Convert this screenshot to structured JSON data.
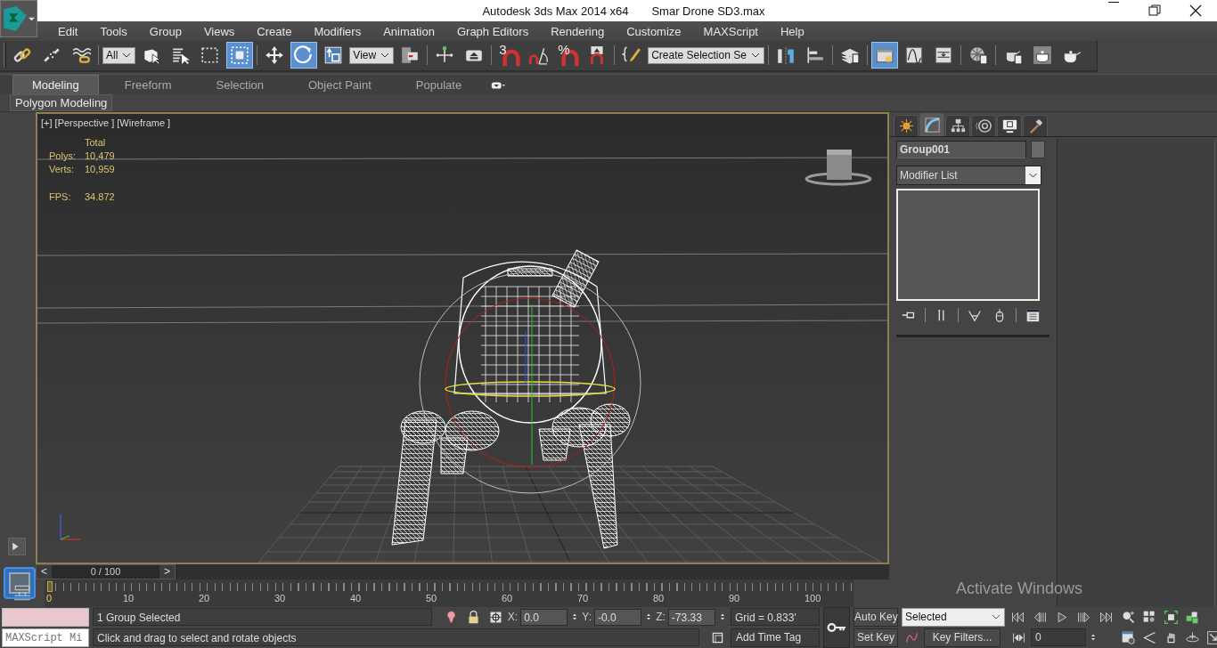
{
  "title_bar": {
    "app": "Autodesk 3ds Max  2014 x64",
    "file": "Smar Drone SD3.max"
  },
  "menu": [
    "Edit",
    "Tools",
    "Group",
    "Views",
    "Create",
    "Modifiers",
    "Animation",
    "Graph Editors",
    "Rendering",
    "Customize",
    "MAXScript",
    "Help"
  ],
  "toolbar": [
    {
      "kind": "link",
      "selected": false
    },
    {
      "kind": "unlink",
      "selected": false
    },
    {
      "kind": "bind",
      "selected": false
    },
    {
      "kind": "separator"
    },
    {
      "kind": "dropdown",
      "value": "All"
    },
    {
      "kind": "select-object",
      "selected": false
    },
    {
      "kind": "select-by-name",
      "selected": false
    },
    {
      "kind": "region-select",
      "selected": false
    },
    {
      "kind": "window-crossing",
      "selected": true
    },
    {
      "kind": "separator"
    },
    {
      "kind": "move",
      "selected": false
    },
    {
      "kind": "rotate",
      "selected": true
    },
    {
      "kind": "scale",
      "selected": false
    },
    {
      "kind": "dropdown",
      "value": "View"
    },
    {
      "kind": "pivot",
      "selected": false
    },
    {
      "kind": "separator"
    },
    {
      "kind": "manipulate",
      "selected": false
    },
    {
      "kind": "keyboard-override",
      "selected": false
    },
    {
      "kind": "separator"
    },
    {
      "kind": "snap",
      "glyph": "3",
      "selected": false
    },
    {
      "kind": "angle-snap",
      "selected": false
    },
    {
      "kind": "snap",
      "glyph": "%",
      "selected": false
    },
    {
      "kind": "spinner-snap",
      "selected": false
    },
    {
      "kind": "separator"
    },
    {
      "kind": "named-sets",
      "selected": false
    },
    {
      "kind": "dropdown",
      "value": "Create Selection Se"
    },
    {
      "kind": "separator"
    },
    {
      "kind": "mirror",
      "selected": false
    },
    {
      "kind": "align",
      "selected": false
    },
    {
      "kind": "separator"
    },
    {
      "kind": "layers",
      "selected": false
    },
    {
      "kind": "separator"
    },
    {
      "kind": "scene-explorer",
      "selected": true
    },
    {
      "kind": "curve-editor",
      "selected": false
    },
    {
      "kind": "schematic",
      "selected": false
    },
    {
      "kind": "separator"
    },
    {
      "kind": "material-editor",
      "selected": false
    },
    {
      "kind": "separator"
    },
    {
      "kind": "render-setup",
      "selected": false
    },
    {
      "kind": "rendered-frame",
      "selected": false
    },
    {
      "kind": "render",
      "selected": false
    }
  ],
  "ribbon": {
    "tabs": [
      {
        "label": "Modeling",
        "selected": true
      },
      {
        "label": "Freeform",
        "selected": false
      },
      {
        "label": "Selection",
        "selected": false
      },
      {
        "label": "Object Paint",
        "selected": false
      },
      {
        "label": "Populate",
        "selected": false
      }
    ],
    "panel": "Polygon Modeling"
  },
  "viewport": {
    "label": "[+] [Perspective ] [Wireframe ]",
    "stats_header": "Total",
    "stats": [
      {
        "label": "Polys:",
        "value": "10,479"
      },
      {
        "label": "Verts:",
        "value": "10,959"
      }
    ],
    "fps_label": "FPS:",
    "fps": "34.872"
  },
  "command_panel": {
    "tabs": [
      {
        "kind": "create",
        "selected": false
      },
      {
        "kind": "modify",
        "selected": true
      },
      {
        "kind": "hierarchy",
        "selected": false
      },
      {
        "kind": "motion",
        "selected": false
      },
      {
        "kind": "display",
        "selected": false
      },
      {
        "kind": "utilities",
        "selected": false
      }
    ],
    "object_name": "Group001",
    "modifier_list": "Modifier List",
    "stack_buttons": [
      {
        "kind": "pin"
      },
      {
        "kind": "end-result"
      },
      {
        "kind": "unique"
      },
      {
        "kind": "remove"
      },
      {
        "kind": "configure"
      }
    ]
  },
  "time_slider": {
    "prev": "<",
    "frame": "0 / 100",
    "next": ">",
    "level": 0
  },
  "track": {
    "current": "0",
    "labels": [
      "10",
      "20",
      "30",
      "40",
      "50",
      "60",
      "70",
      "80",
      "90",
      "100"
    ]
  },
  "status": {
    "listener": "MAXScript Mi",
    "selection": "1 Group Selected",
    "prompt": "Click and drag to select and rotate objects",
    "coords": [
      {
        "label": "X:",
        "value": "0.0"
      },
      {
        "label": "Y:",
        "value": "-0.0"
      },
      {
        "label": "Z:",
        "value": "-73.33"
      }
    ],
    "grid": "Grid = 0.833'",
    "time_tag": "Add Time Tag",
    "auto_key": "Auto Key",
    "set_key": "Set Key",
    "key_mode": "Selected",
    "key_filters": "Key Filters...",
    "frame": "0"
  },
  "activation": {
    "title": "Activate Windows"
  }
}
